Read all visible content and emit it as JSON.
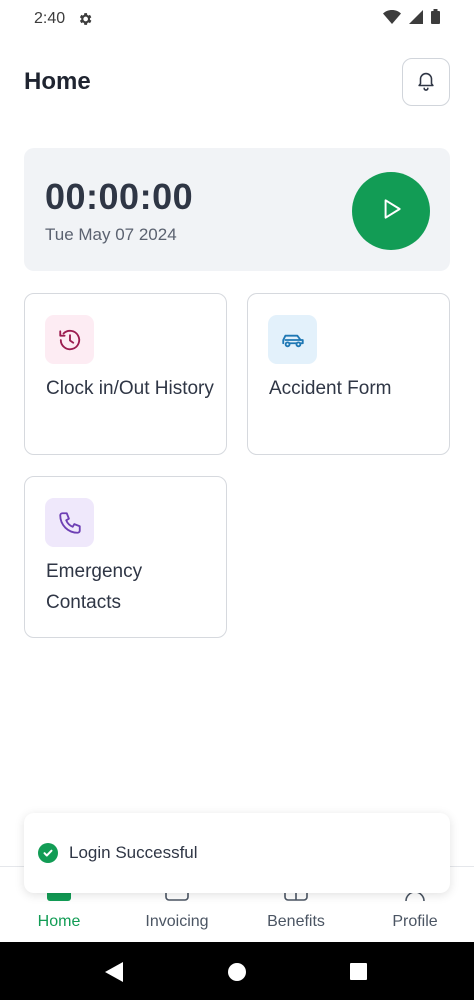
{
  "status_bar": {
    "time": "2:40"
  },
  "header": {
    "title": "Home"
  },
  "timer": {
    "value": "00:00:00",
    "date": "Tue May 07 2024"
  },
  "tiles": [
    {
      "label": "Clock in/Out History",
      "icon": "clock-history-icon",
      "bg": "#fdecf3",
      "color": "#9b1c4f"
    },
    {
      "label": "Accident Form",
      "icon": "car-icon",
      "bg": "#e3f1fb",
      "color": "#1f78b4"
    },
    {
      "label": "Emergency Contacts",
      "icon": "phone-icon",
      "bg": "#efe8fb",
      "color": "#6d3fb4"
    }
  ],
  "toast": {
    "message": "Login Successful"
  },
  "bottom_nav": {
    "items": [
      {
        "label": "Home",
        "icon": "home-icon",
        "active": true
      },
      {
        "label": "Invoicing",
        "icon": "invoice-icon",
        "active": false
      },
      {
        "label": "Benefits",
        "icon": "gift-icon",
        "active": false
      },
      {
        "label": "Profile",
        "icon": "user-icon",
        "active": false
      }
    ]
  },
  "colors": {
    "accent": "#129c55",
    "card_bg": "#f1f3f6",
    "text": "#2f3645"
  }
}
